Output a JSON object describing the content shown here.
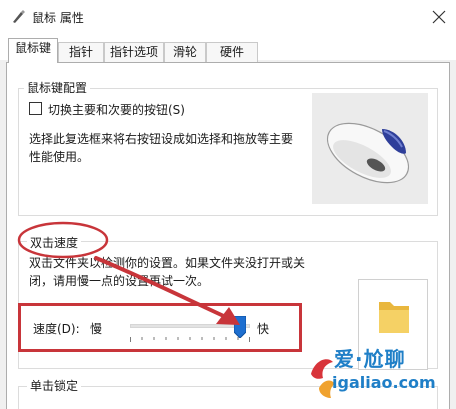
{
  "window": {
    "title": "鼠标 属性"
  },
  "tabs": [
    {
      "label": "鼠标键",
      "active": true
    },
    {
      "label": "指针",
      "active": false
    },
    {
      "label": "指针选项",
      "active": false
    },
    {
      "label": "滑轮",
      "active": false
    },
    {
      "label": "硬件",
      "active": false
    }
  ],
  "button_config": {
    "title": "鼠标键配置",
    "checkbox_label": "切换主要和次要的按钮(S)",
    "checkbox_checked": false,
    "description_line1": "选择此复选框来将右按钮设成如选择和拖放等主要",
    "description_line2": "性能使用。"
  },
  "double_click": {
    "title": "双击速度",
    "description_line1": "双击文件夹以检测你的设置。如果文件夹没打开或关",
    "description_line2": "闭，请用慢一点的设置再试一次。",
    "speed_label": "速度(D):",
    "slow_label": "慢",
    "fast_label": "快",
    "speed_value_fraction": 0.92
  },
  "click_lock": {
    "title": "单击锁定"
  },
  "watermark": {
    "brand": "爱·尬聊",
    "domain": "igaliao.com"
  },
  "colors": {
    "annotation": "#c8353a",
    "watermark": "#1f7fc7",
    "folder": "#f2c94c"
  }
}
